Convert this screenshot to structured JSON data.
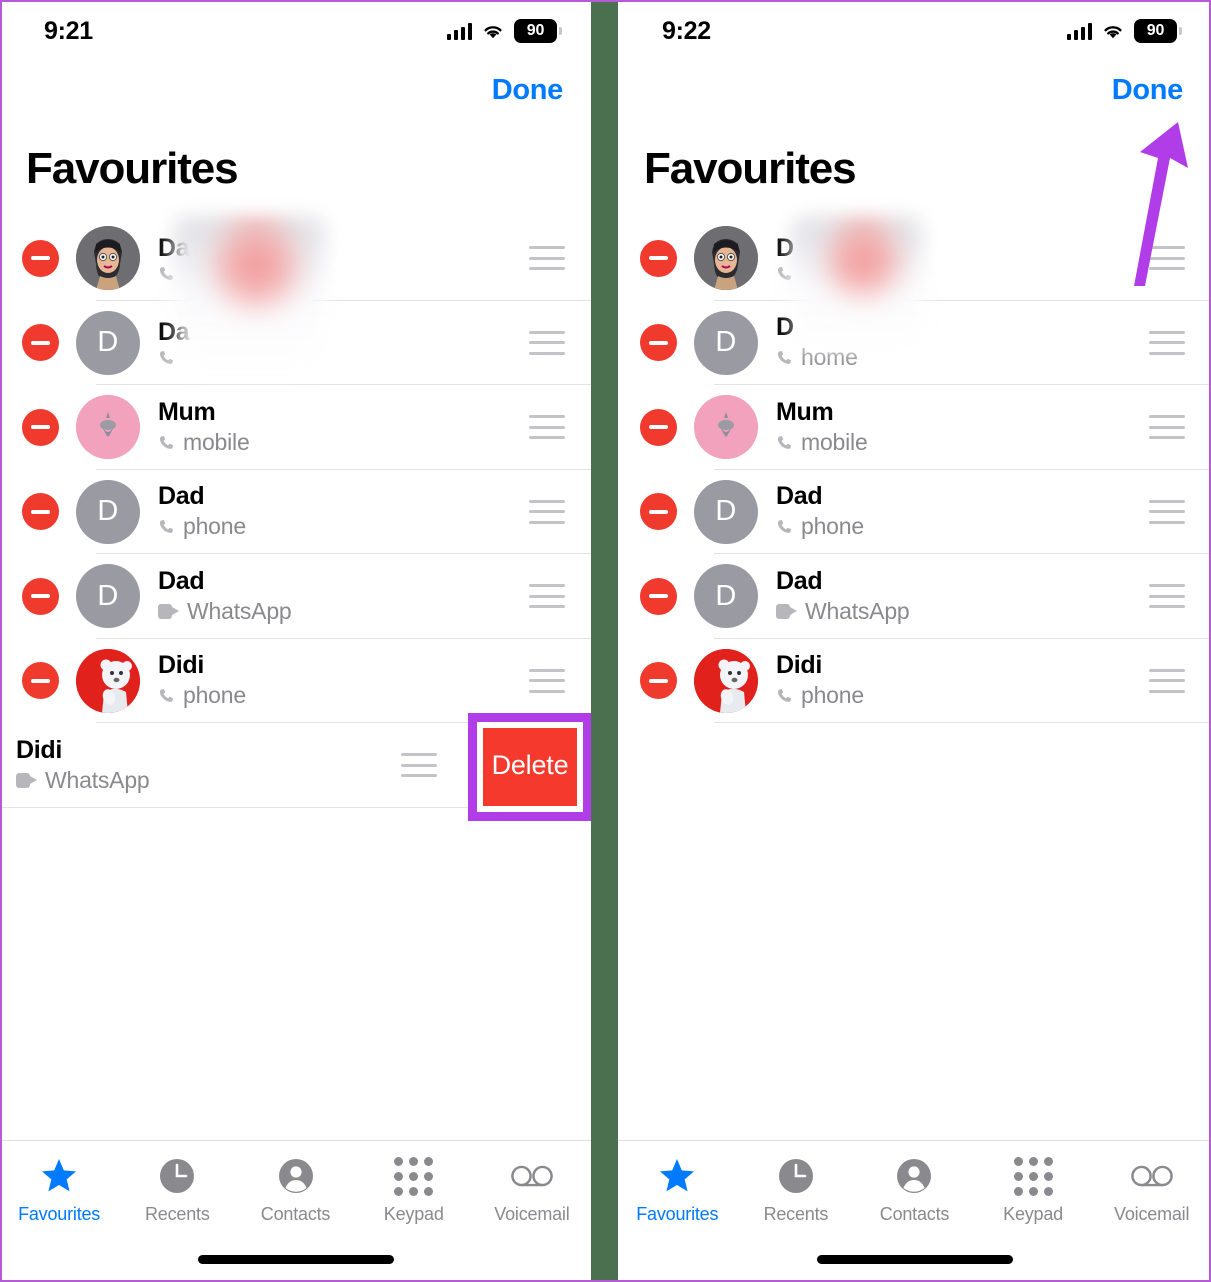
{
  "meta": {
    "app": "Phone",
    "screen": "Favourites (Edit mode)",
    "accent_blue": "#007AFF",
    "destructive_red": "#EF3A2D",
    "delete_red": "#F5392C",
    "callout_purple": "#B13DE8",
    "divider_green": "#4a7050"
  },
  "panels": [
    {
      "id": "left",
      "status": {
        "time": "9:21",
        "battery": "90",
        "signal_icon": "cellular-signal-icon",
        "wifi_icon": "wifi-icon",
        "battery_icon": "battery-icon"
      },
      "nav": {
        "done_label": "Done"
      },
      "title": "Favourites",
      "rows": [
        {
          "name": "Da",
          "name_redacted": true,
          "sub": "",
          "sub_redacted": true,
          "sub_icon": "phone-icon",
          "avatar": "memoji",
          "initial": ""
        },
        {
          "name": "Da",
          "name_redacted": true,
          "sub": "",
          "sub_redacted": true,
          "sub_icon": "phone-icon",
          "avatar": "initial",
          "initial": "D"
        },
        {
          "name": "Mum",
          "name_redacted": false,
          "sub": "mobile",
          "sub_redacted": false,
          "sub_icon": "phone-icon",
          "avatar": "pinky",
          "initial": ""
        },
        {
          "name": "Dad",
          "name_redacted": false,
          "sub": "phone",
          "sub_redacted": false,
          "sub_icon": "phone-icon",
          "avatar": "initial",
          "initial": "D"
        },
        {
          "name": "Dad",
          "name_redacted": false,
          "sub": "WhatsApp",
          "sub_redacted": false,
          "sub_icon": "video-icon",
          "avatar": "initial",
          "initial": "D"
        },
        {
          "name": "Didi",
          "name_redacted": false,
          "sub": "phone",
          "sub_redacted": false,
          "sub_icon": "phone-icon",
          "avatar": "bear",
          "initial": ""
        },
        {
          "name": "Didi",
          "name_redacted": false,
          "sub": "WhatsApp",
          "sub_redacted": false,
          "sub_icon": "video-icon",
          "avatar": "bear",
          "initial": "",
          "swiped": true,
          "delete_label": "Delete"
        }
      ],
      "tabs": [
        {
          "label": "Favourites",
          "icon": "star-icon",
          "active": true
        },
        {
          "label": "Recents",
          "icon": "clock-icon",
          "active": false
        },
        {
          "label": "Contacts",
          "icon": "person-icon",
          "active": false
        },
        {
          "label": "Keypad",
          "icon": "keypad-icon",
          "active": false
        },
        {
          "label": "Voicemail",
          "icon": "voicemail-icon",
          "active": false
        }
      ]
    },
    {
      "id": "right",
      "status": {
        "time": "9:22",
        "battery": "90",
        "signal_icon": "cellular-signal-icon",
        "wifi_icon": "wifi-icon",
        "battery_icon": "battery-icon"
      },
      "nav": {
        "done_label": "Done"
      },
      "title": "Favourites",
      "annotation": {
        "type": "arrow",
        "points_to": "done-button",
        "color": "#B13DE8"
      },
      "rows": [
        {
          "name": "D",
          "name_redacted": true,
          "sub": "",
          "sub_redacted": true,
          "sub_icon": "phone-icon",
          "avatar": "memoji",
          "initial": ""
        },
        {
          "name": "D",
          "name_redacted": true,
          "sub": "home",
          "sub_redacted": false,
          "sub_icon": "phone-icon",
          "avatar": "initial",
          "initial": "D"
        },
        {
          "name": "Mum",
          "name_redacted": false,
          "sub": "mobile",
          "sub_redacted": false,
          "sub_icon": "phone-icon",
          "avatar": "pinky",
          "initial": ""
        },
        {
          "name": "Dad",
          "name_redacted": false,
          "sub": "phone",
          "sub_redacted": false,
          "sub_icon": "phone-icon",
          "avatar": "initial",
          "initial": "D"
        },
        {
          "name": "Dad",
          "name_redacted": false,
          "sub": "WhatsApp",
          "sub_redacted": false,
          "sub_icon": "video-icon",
          "avatar": "initial",
          "initial": "D"
        },
        {
          "name": "Didi",
          "name_redacted": false,
          "sub": "phone",
          "sub_redacted": false,
          "sub_icon": "phone-icon",
          "avatar": "bear",
          "initial": ""
        }
      ],
      "tabs": [
        {
          "label": "Favourites",
          "icon": "star-icon",
          "active": true
        },
        {
          "label": "Recents",
          "icon": "clock-icon",
          "active": false
        },
        {
          "label": "Contacts",
          "icon": "person-icon",
          "active": false
        },
        {
          "label": "Keypad",
          "icon": "keypad-icon",
          "active": false
        },
        {
          "label": "Voicemail",
          "icon": "voicemail-icon",
          "active": false
        }
      ]
    }
  ]
}
